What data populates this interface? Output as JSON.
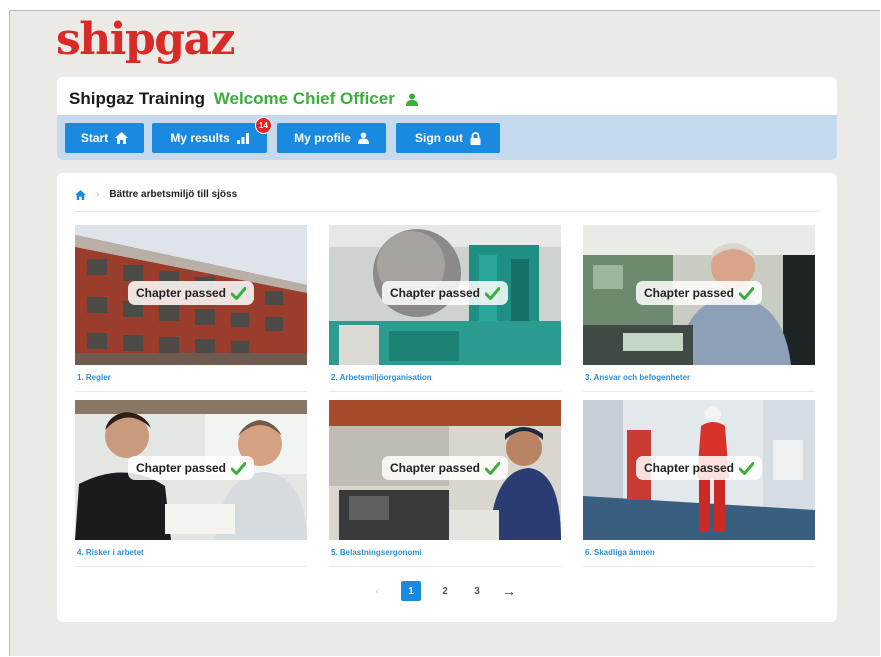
{
  "brand": {
    "logo_text": "shipgaz",
    "logo_color": "#d82a26"
  },
  "header": {
    "title": "Shipgaz Training",
    "welcome": "Welcome Chief Officer",
    "user_icon": "person-icon"
  },
  "nav": {
    "start": {
      "label": "Start",
      "icon": "home-icon"
    },
    "results": {
      "label": "My results",
      "icon": "bar-chart-icon",
      "badge": "14"
    },
    "profile": {
      "label": "My profile",
      "icon": "person-icon"
    },
    "signout": {
      "label": "Sign out",
      "icon": "lock-icon"
    }
  },
  "breadcrumb": {
    "home_icon": "home-icon",
    "separator": "›",
    "current": "Bättre arbetsmiljö till sjöss"
  },
  "chapters": [
    {
      "caption": "1. Regler",
      "status": "Chapter passed"
    },
    {
      "caption": "2. Arbetsmiljöorganisation",
      "status": "Chapter passed"
    },
    {
      "caption": "3. Ansvar och befogenheter",
      "status": "Chapter passed"
    },
    {
      "caption": "4. Risker i arbetet",
      "status": "Chapter passed"
    },
    {
      "caption": "5. Belastningsergonomi",
      "status": "Chapter passed"
    },
    {
      "caption": "6. Skadliga ämnen",
      "status": "Chapter passed"
    }
  ],
  "pagination": {
    "prev": "‹",
    "pages": [
      "1",
      "2",
      "3"
    ],
    "current": "1",
    "next": "→"
  },
  "colors": {
    "primary": "#1a8ae0",
    "navbar": "#c5d9ef",
    "success": "#3cae3c",
    "link": "#2c8fd6",
    "badge": "#e02424"
  }
}
